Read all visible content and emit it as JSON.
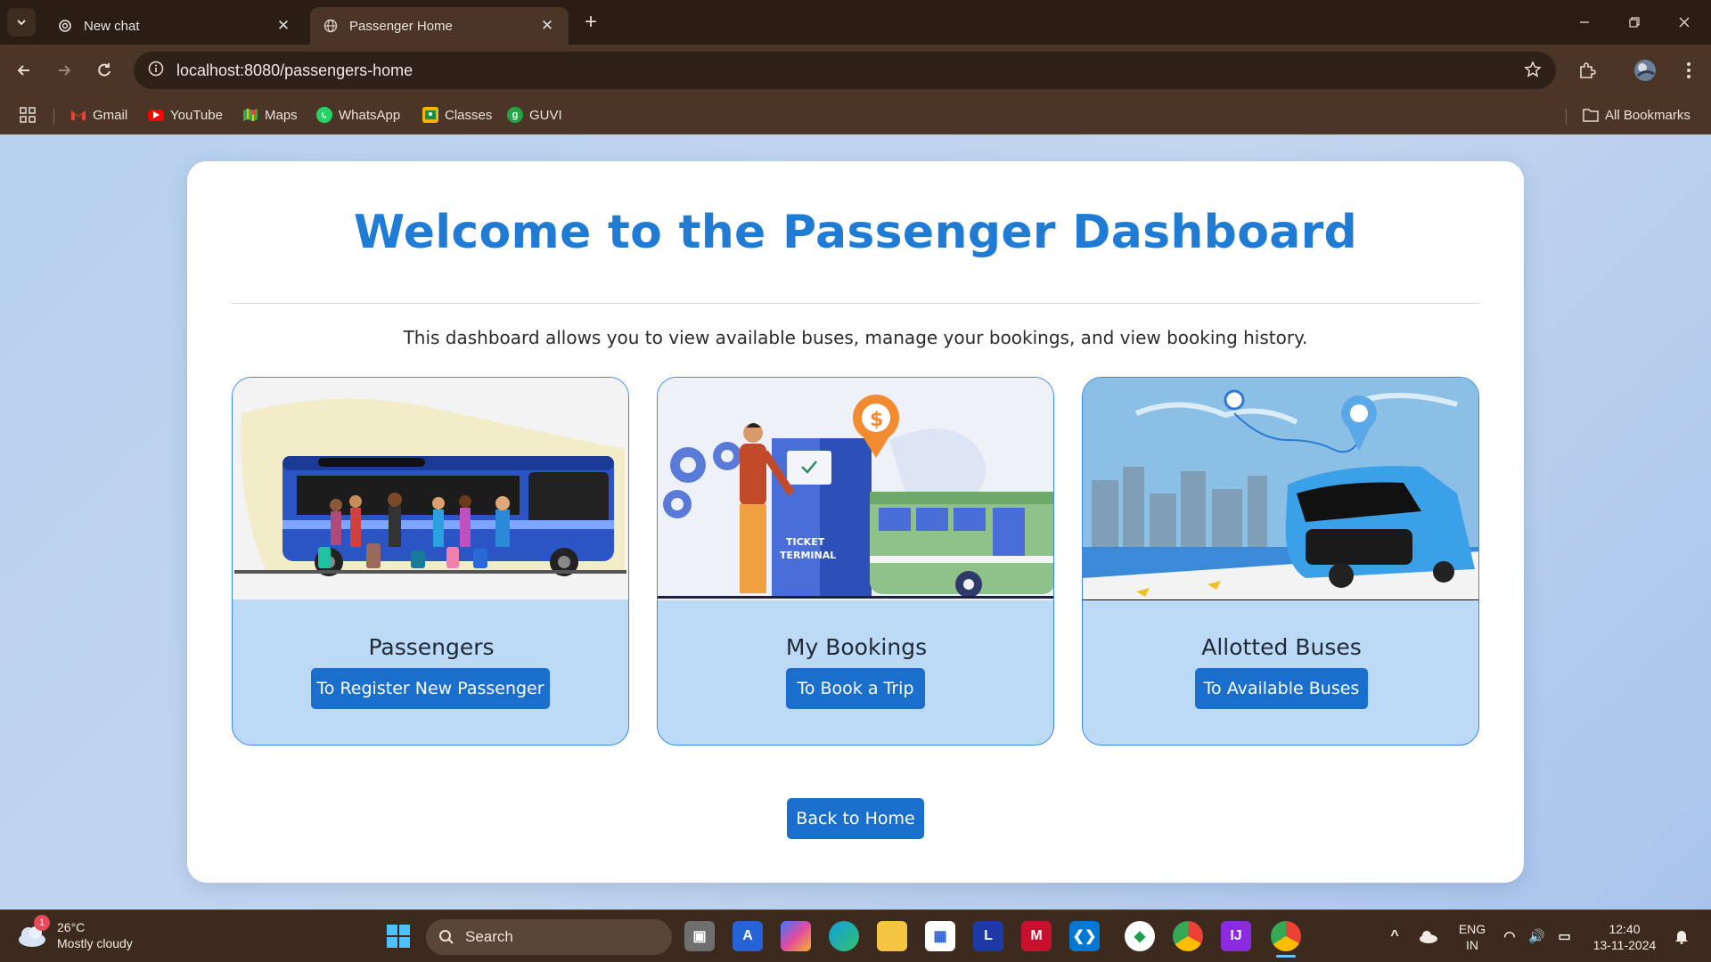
{
  "browser": {
    "tabs": [
      {
        "title": "New chat",
        "icon": "openai-icon",
        "active": false
      },
      {
        "title": "Passenger Home",
        "icon": "globe-icon",
        "active": true
      }
    ],
    "url": "localhost:8080/passengers-home",
    "bookmarks": [
      {
        "label": "Gmail",
        "icon": "gmail-icon",
        "color": "#ea4335"
      },
      {
        "label": "YouTube",
        "icon": "youtube-icon",
        "color": "#ff0000"
      },
      {
        "label": "Maps",
        "icon": "maps-icon",
        "color": "#34a853"
      },
      {
        "label": "WhatsApp",
        "icon": "whatsapp-icon",
        "color": "#25d366"
      },
      {
        "label": "Classes",
        "icon": "classroom-icon",
        "color": "#f4b400"
      },
      {
        "label": "GUVI",
        "icon": "guvi-icon",
        "color": "#22a447"
      }
    ],
    "all_bookmarks": "All Bookmarks"
  },
  "page": {
    "title": "Welcome to the Passenger Dashboard",
    "subtitle": "This dashboard allows you to view available buses, manage your bookings, and view booking history.",
    "cards": [
      {
        "title": "Passengers",
        "button": "To Register New Passenger",
        "image": "passengers-with-bus-illustration"
      },
      {
        "title": "My Bookings",
        "button": "To Book a Trip",
        "image": "ticket-terminal-illustration",
        "terminal_text_1": "TICKET",
        "terminal_text_2": "TERMINAL"
      },
      {
        "title": "Allotted Buses",
        "button": "To Available Buses",
        "image": "bus-route-city-illustration"
      }
    ],
    "back_button": "Back to Home",
    "colors": {
      "accent": "#1f7bd3",
      "button": "#1a6fcd",
      "card_bg": "#bcdaf5",
      "card_border": "#3d8be0"
    }
  },
  "taskbar": {
    "weather_temp": "26°C",
    "weather_desc": "Mostly cloudy",
    "weather_badge": "1",
    "search_placeholder": "Search",
    "lang_1": "ENG",
    "lang_2": "IN",
    "time": "12:40",
    "date": "13-11-2024"
  }
}
